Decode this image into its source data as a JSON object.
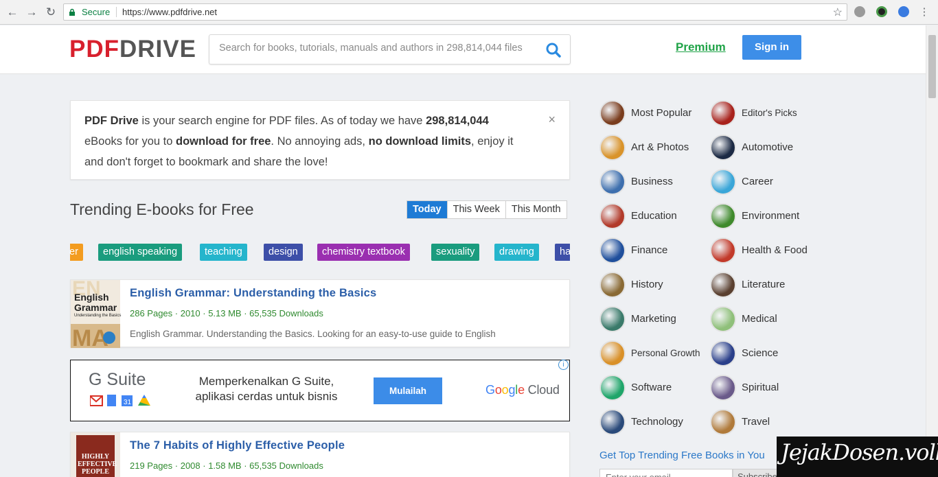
{
  "browser": {
    "secure_label": "Secure",
    "url": "https://www.pdfdrive.net"
  },
  "header": {
    "logo_part1": "PDF",
    "logo_part2": "DRIVE",
    "search_placeholder": "Search for books, tutorials, manuals and authors in 298,814,044 files",
    "premium_label": "Premium",
    "signin_label": "Sign in"
  },
  "intro": {
    "brand": "PDF Drive",
    "text1": " is your search engine for PDF files. As of today we have ",
    "count": "298,814,044",
    "text2": " eBooks for you to ",
    "bold1": "download for free",
    "text3": ". No annoying ads, ",
    "bold2": "no download limits",
    "text4": ", enjoy it and don't forget to bookmark and share the love!",
    "close": "×"
  },
  "trending": {
    "title": "Trending E-books for Free",
    "tabs": [
      "Today",
      "This Week",
      "This Month"
    ],
    "active_tab": "Today",
    "tags": [
      {
        "label": "ter",
        "color": "#f39c1f"
      },
      {
        "label": "english speaking",
        "color": "#1a9c7e"
      },
      {
        "label": "teaching",
        "color": "#25b5cc"
      },
      {
        "label": "design",
        "color": "#3d4fa8"
      },
      {
        "label": "chemistry textbook",
        "color": "#9a2fb0"
      },
      {
        "label": "sexuality",
        "color": "#1a9c7e"
      },
      {
        "label": "drawing",
        "color": "#25b5cc"
      },
      {
        "label": "ha",
        "color": "#3d4fa8"
      }
    ]
  },
  "books": [
    {
      "title": "English Grammar: Understanding the Basics",
      "meta": "286 Pages · 2010 · 5.13 MB · 65,535 Downloads",
      "desc": "English Grammar. Understanding the Basics. Looking for an easy-to-use guide to English",
      "cover_line1": "English",
      "cover_line2": "Grammar",
      "cover_line3": "Understanding the Basics"
    },
    {
      "title": "The 7 Habits of Highly Effective People",
      "meta": "219 Pages · 2008 · 1.58 MB · 65,535 Downloads",
      "cover_line1": "HIGHLY",
      "cover_line2": "EFFECTIVE",
      "cover_line3": "PEOPLE"
    }
  ],
  "ad": {
    "brand": "G Suite",
    "text_line1": "Memperkenalkan G Suite,",
    "text_line2": "aplikasi cerdas untuk bisnis",
    "button": "Mulailah",
    "partner_google": "Google",
    "partner_cloud": " Cloud",
    "info": "i"
  },
  "categories": [
    {
      "label": "Most Popular",
      "icon": "most-popular-icon",
      "color": "#7a3d1e"
    },
    {
      "label": "Editor's Picks",
      "icon": "editors-picks-icon",
      "color": "#a8221c"
    },
    {
      "label": "Art & Photos",
      "icon": "art-photos-icon",
      "color": "#d9932a"
    },
    {
      "label": "Automotive",
      "icon": "automotive-icon",
      "color": "#1c2a44"
    },
    {
      "label": "Business",
      "icon": "business-icon",
      "color": "#3e6fae"
    },
    {
      "label": "Career",
      "icon": "career-icon",
      "color": "#3aa6d8"
    },
    {
      "label": "Education",
      "icon": "education-icon",
      "color": "#b23a2a"
    },
    {
      "label": "Environment",
      "icon": "environment-icon",
      "color": "#3f8a2c"
    },
    {
      "label": "Finance",
      "icon": "finance-icon",
      "color": "#1f4f9c"
    },
    {
      "label": "Health & Food",
      "icon": "health-food-icon",
      "color": "#c23a2a"
    },
    {
      "label": "History",
      "icon": "history-icon",
      "color": "#8a6a34"
    },
    {
      "label": "Literature",
      "icon": "literature-icon",
      "color": "#5a4030"
    },
    {
      "label": "Marketing",
      "icon": "marketing-icon",
      "color": "#3a7a6a"
    },
    {
      "label": "Medical",
      "icon": "medical-icon",
      "color": "#8fc07a"
    },
    {
      "label": "Personal Growth",
      "icon": "personal-growth-icon",
      "color": "#d99028"
    },
    {
      "label": "Science",
      "icon": "science-icon",
      "color": "#2a3f8a"
    },
    {
      "label": "Software",
      "icon": "software-icon",
      "color": "#1fa56a"
    },
    {
      "label": "Spiritual",
      "icon": "spiritual-icon",
      "color": "#6a5a8a"
    },
    {
      "label": "Technology",
      "icon": "technology-icon",
      "color": "#2a4a7a"
    },
    {
      "label": "Travel",
      "icon": "travel-icon",
      "color": "#b07a3a"
    }
  ],
  "sidebar": {
    "get_top": "Get Top Trending Free Books in You",
    "email_placeholder": "Enter your email",
    "subscribe": "Subscribe"
  },
  "watermark": {
    "text": "JejakDosen.vollll"
  }
}
